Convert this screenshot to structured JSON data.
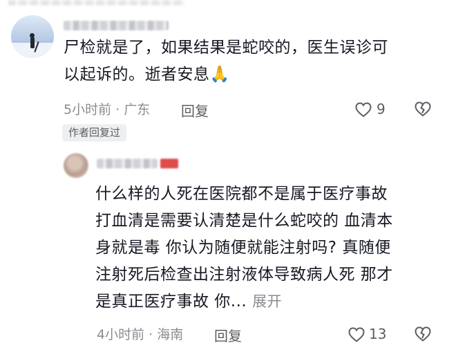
{
  "comment": {
    "text_line1": "尸检就是了，如果结果是蛇咬的，医生误诊可",
    "text_line2": "以起诉的。逝者安息🙏",
    "meta": "5小时前 · 广东",
    "reply_label": "回复",
    "like_count": "9",
    "author_replied_badge": "作者回复过"
  },
  "reply": {
    "lines": [
      "什么样的人死在医院都不是属于医疗事故",
      "打血清是需要认清楚是什么蛇咬的  血清本",
      "身就是毒  你认为随便就能注射吗? 真随便",
      "注射死后检查出注射液体导致病人死 那才",
      "是真正医疗事故  你..."
    ],
    "expand_label": "展开",
    "meta": "4小时前 · 海南",
    "reply_label": "回复",
    "like_count": "13"
  },
  "icons": {
    "like": "heart-outline-icon",
    "dislike": "broken-heart-icon"
  },
  "colors": {
    "text": "#161823",
    "meta": "#8a8b91",
    "badge_bg": "#eeeff1"
  }
}
